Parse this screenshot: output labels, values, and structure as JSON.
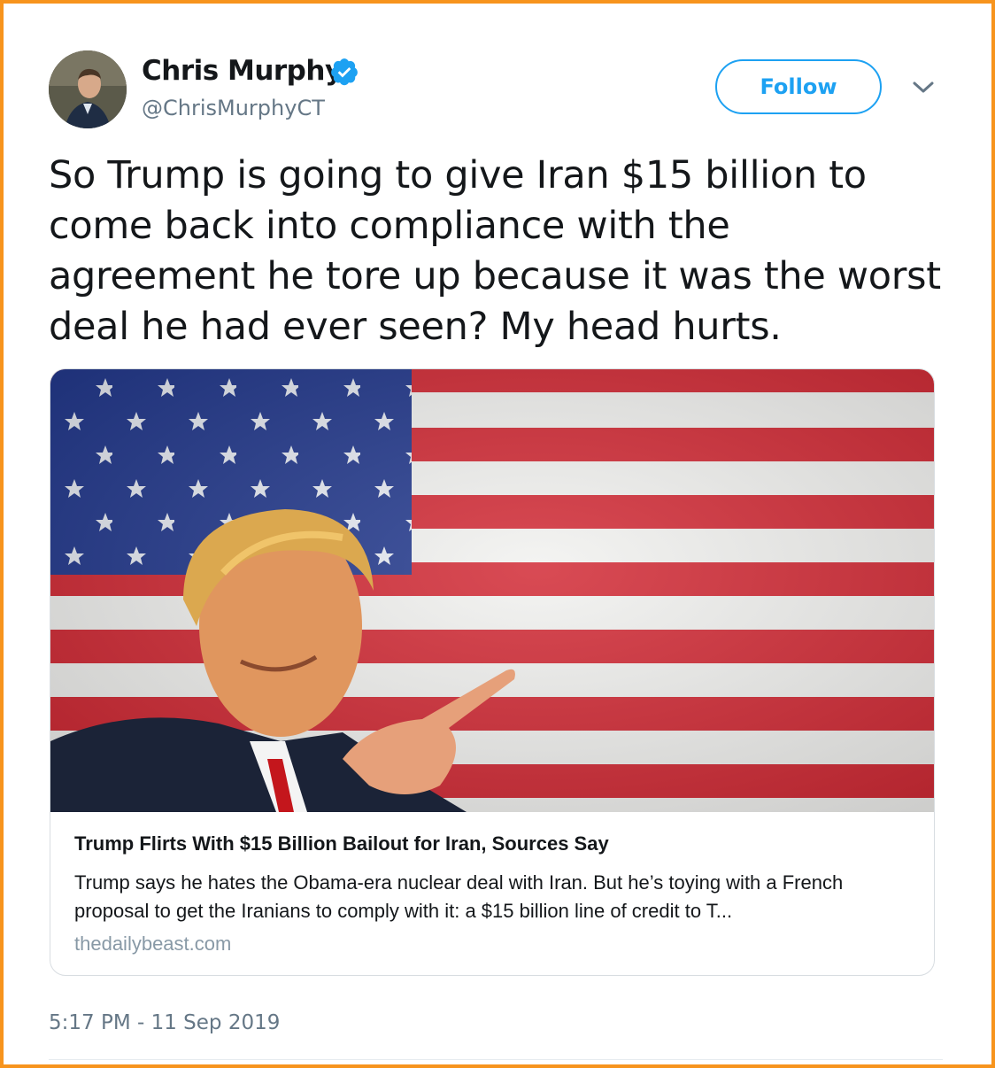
{
  "author": {
    "name": "Chris Murphy",
    "handle": "@ChrisMurphyCT",
    "verified": true
  },
  "follow_label": "Follow",
  "tweet": {
    "text": "So Trump is going to give Iran $15 billion to come back into compliance with the agreement he tore up because it was the worst deal he had ever seen? My head hurts."
  },
  "card": {
    "title": "Trump Flirts With $15 Billion Bailout for Iran, Sources Say",
    "description": "Trump says he hates the Obama-era nuclear deal with Iran. But he’s toying with a French proposal to get the Iranians to comply with it: a $15 billion line of credit to T...",
    "domain": "thedailybeast.com"
  },
  "timestamp": "5:17 PM - 11 Sep 2019",
  "colors": {
    "accent": "#1da1f2",
    "frame": "#f7941d",
    "text": "#14171a",
    "muted": "#657786"
  },
  "icons": [
    "verified-badge-icon",
    "chevron-down-icon"
  ]
}
